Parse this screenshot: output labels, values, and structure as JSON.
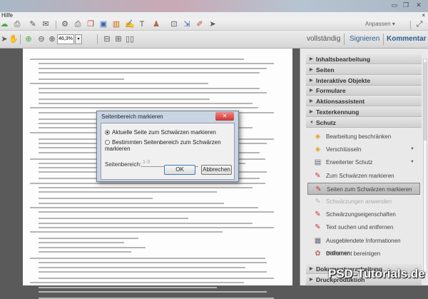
{
  "menubar": {
    "item": "Hilfe",
    "close": "×"
  },
  "window": {
    "minimize": "▭",
    "restore": "❐",
    "close": "✕"
  },
  "toolbar": {
    "anpassen": "Anpassen ▾",
    "zoom": "46,3%",
    "zoom_dd": "▾",
    "vollstaendig": "vollständig",
    "signieren": "Signieren",
    "kommentar": "Kommentar"
  },
  "panel": {
    "sections_top": [
      "Inhaltsbearbeitung",
      "Seiten",
      "Interaktive Objekte",
      "Formulare",
      "Aktionsassistent",
      "Texterkennung"
    ],
    "open_section": "Schutz",
    "items": [
      "Bearbeitung beschränken",
      "Verschlüsseln",
      "Erweiterter Schutz",
      "Zum Schwärzen markieren",
      "Seiten zum Schwärzen markieren",
      "Schwärzungen anwenden",
      "Schwärzungseigenschaften",
      "Text suchen und entfernen",
      "Ausgeblendete Informationen entfernen",
      "Dokument bereinigen"
    ],
    "sections_bottom": [
      "Dokumentverarbeitung",
      "Druckproduktion"
    ]
  },
  "dialog": {
    "title": "Seitenbereich markieren",
    "close": "✕",
    "option1": "Aktuelle Seite zum Schwärzen markieren",
    "option2": "Bestimmten Seitenbereich zum Schwärzen markieren",
    "range_label": "Seitenbereich:",
    "range_value": "1-3",
    "ok": "OK",
    "cancel": "Abbrechen"
  },
  "watermark": "PSD-Tutorials.de"
}
